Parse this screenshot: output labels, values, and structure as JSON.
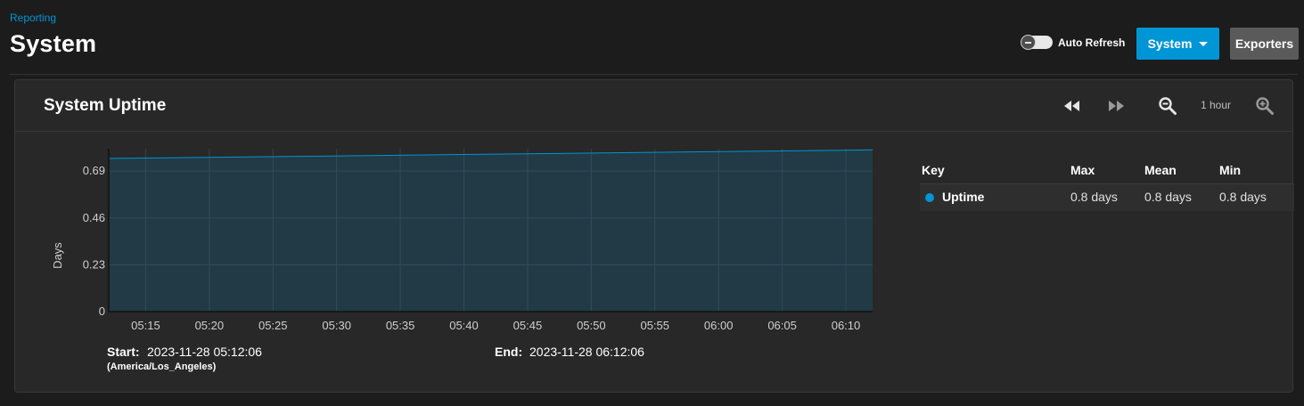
{
  "breadcrumb": "Reporting",
  "page_title": "System",
  "auto_refresh": {
    "label": "Auto Refresh",
    "enabled": false
  },
  "buttons": {
    "system": "System",
    "exporters": "Exporters"
  },
  "card": {
    "title": "System Uptime",
    "zoom_label": "1 hour",
    "icons": [
      "rewind-icon",
      "fast-forward-icon",
      "zoom-out-icon",
      "zoom-in-icon"
    ]
  },
  "chart_data": {
    "type": "area",
    "ylabel": "Days",
    "y_ticks": [
      "0",
      "0.23",
      "0.46",
      "0.69"
    ],
    "ylim": [
      0,
      0.8
    ],
    "x_ticks": [
      "05:15",
      "05:20",
      "05:25",
      "05:30",
      "05:35",
      "05:40",
      "05:45",
      "05:50",
      "05:55",
      "06:00",
      "06:05",
      "06:10"
    ],
    "series": [
      {
        "name": "Uptime",
        "color": "#0095d5",
        "x": [
          "05:12:06",
          "06:12:06"
        ],
        "values": [
          0.752,
          0.794
        ]
      }
    ],
    "grid": true
  },
  "time_range": {
    "start_label": "Start:",
    "start_value": "2023-11-28 05:12:06",
    "timezone": "(America/Los_Angeles)",
    "end_label": "End:",
    "end_value": "2023-11-28 06:12:06"
  },
  "legend": {
    "headers": [
      "Key",
      "Max",
      "Mean",
      "Min"
    ],
    "rows": [
      {
        "name": "Uptime",
        "color": "#0095d5",
        "max": "0.8 days",
        "mean": "0.8 days",
        "min": "0.8 days"
      }
    ]
  }
}
